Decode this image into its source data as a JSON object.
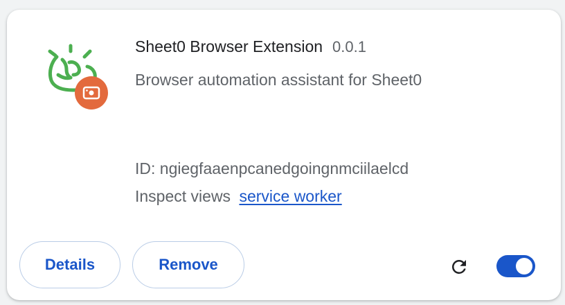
{
  "extension": {
    "name": "Sheet0 Browser Extension",
    "version": "0.0.1",
    "description": "Browser automation assistant for Sheet0",
    "id_text": "ID: ngiegfaaenpcanedgoingnmciilaelcd",
    "inspect_label": "Inspect views",
    "inspect_link": "service worker",
    "enabled": true
  },
  "buttons": {
    "details": "Details",
    "remove": "Remove"
  },
  "icons": {
    "logo": "sheet0-logo-icon",
    "badge": "camera-badge-icon",
    "reload": "reload-icon"
  },
  "colors": {
    "accent": "#1a56c9",
    "logo_green": "#4caf50",
    "badge_orange": "#e36a3d"
  }
}
